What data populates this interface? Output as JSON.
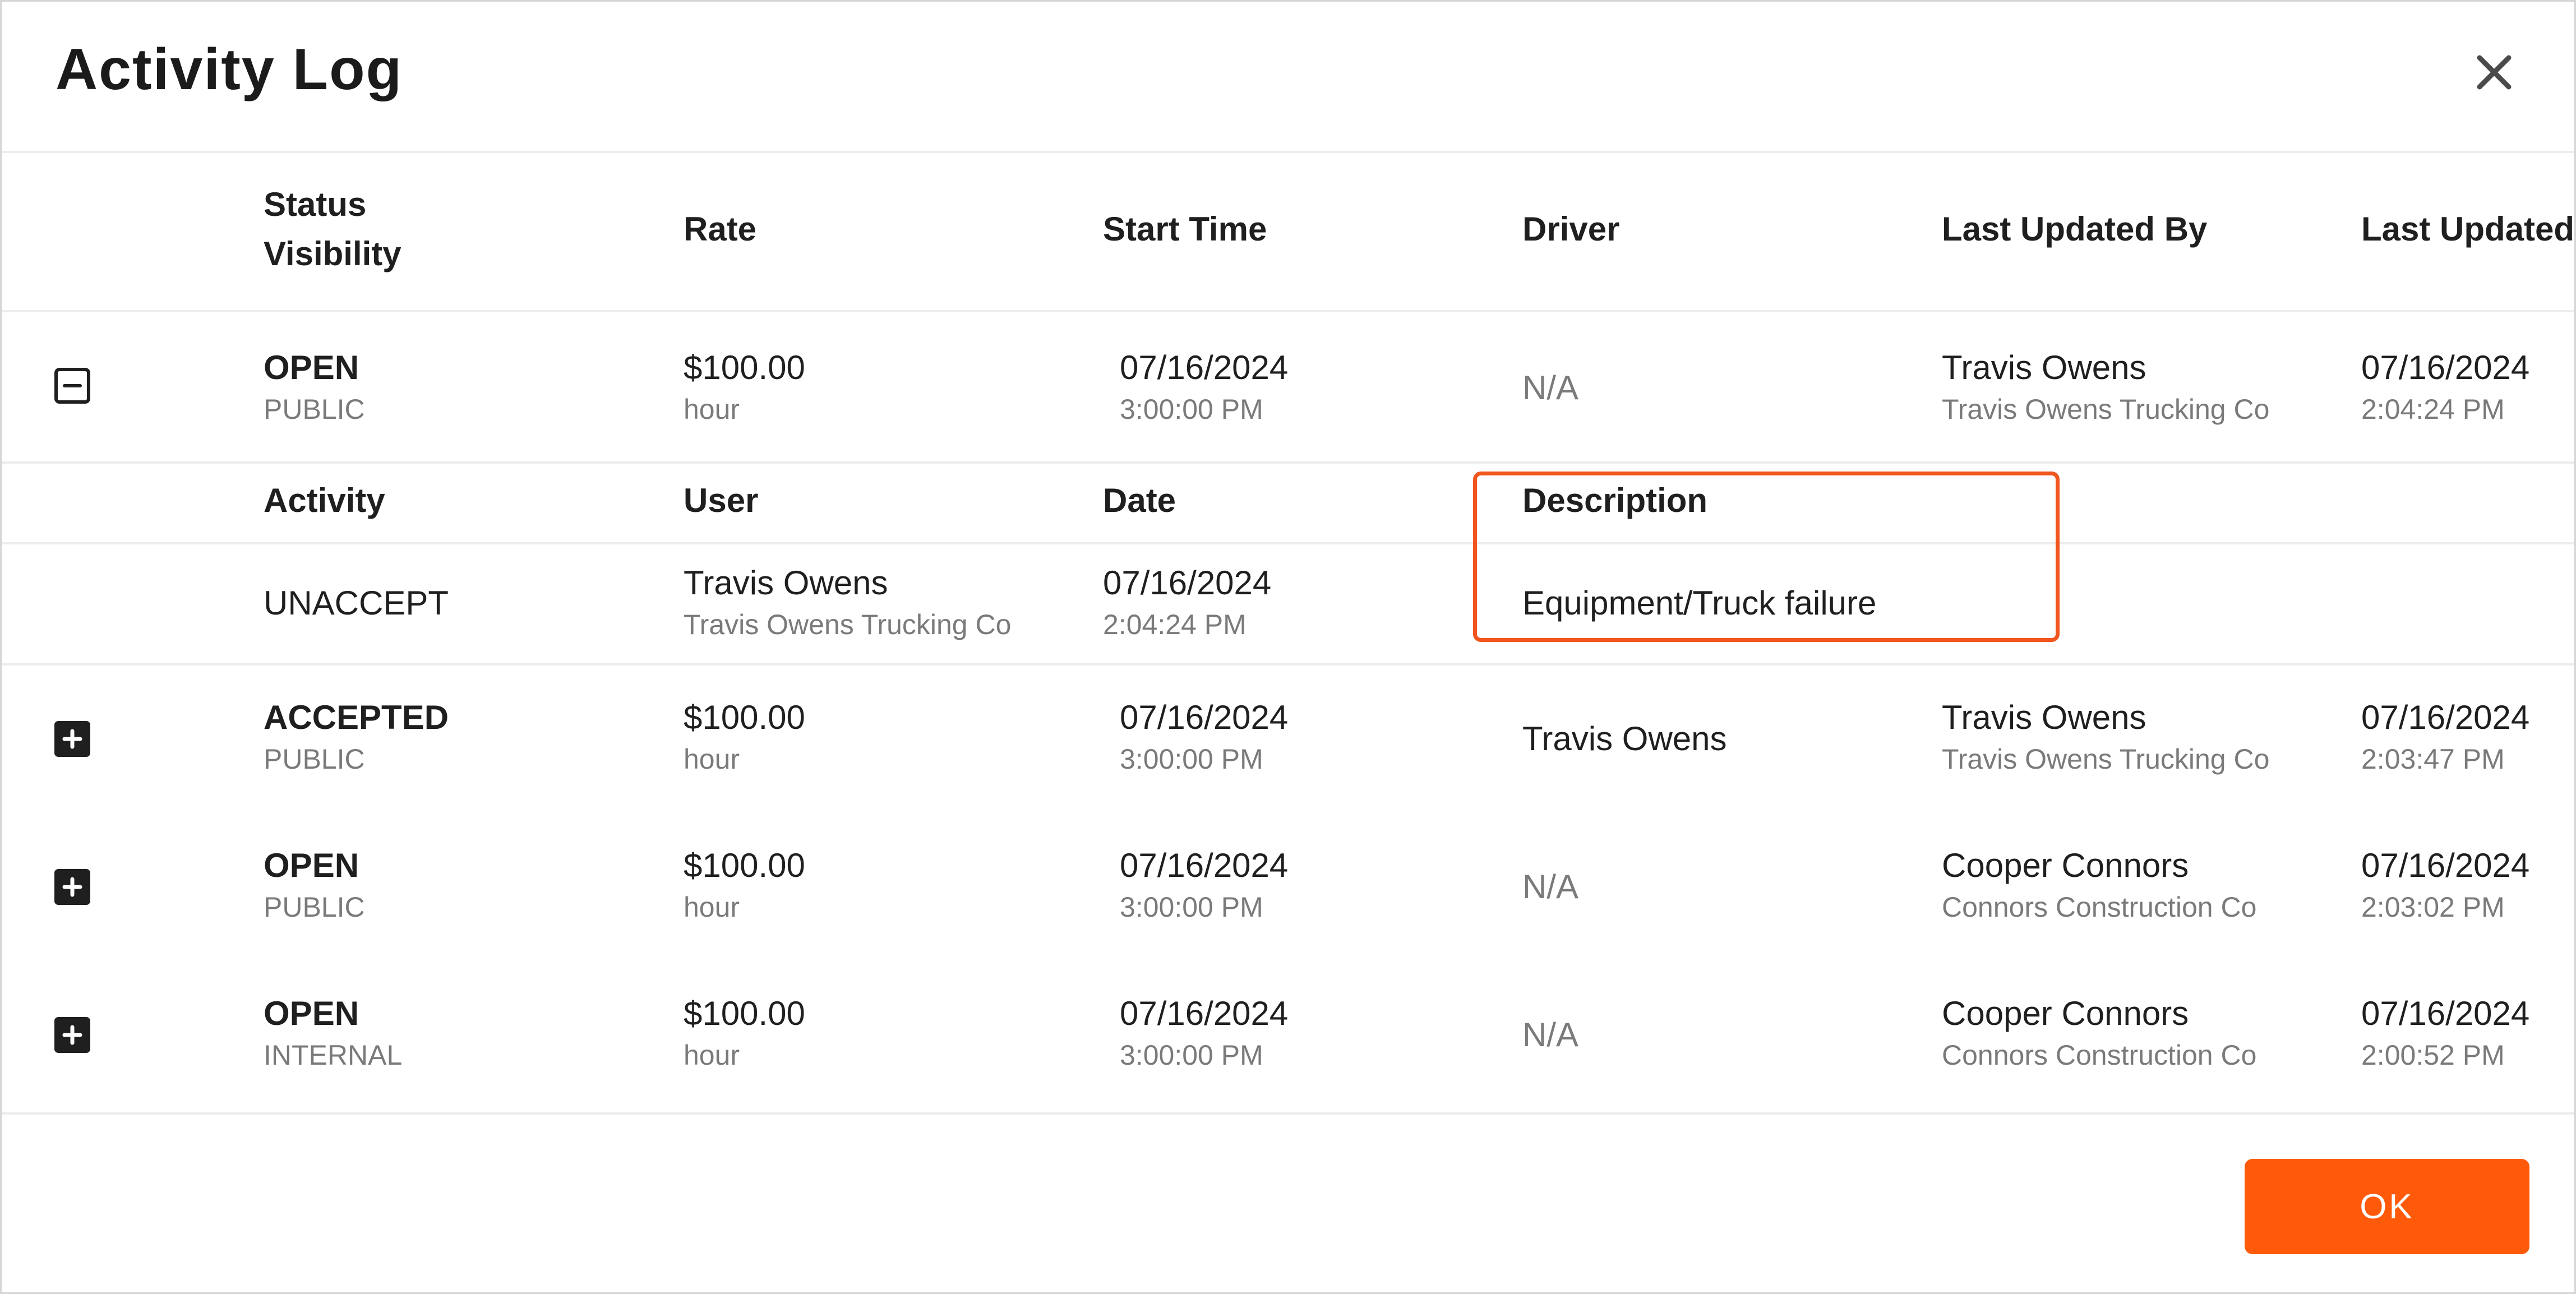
{
  "dialog": {
    "title": "Activity Log",
    "ok_label": "OK"
  },
  "columns": {
    "status": "Status",
    "visibility": "Visibility",
    "rate": "Rate",
    "start_time": "Start Time",
    "driver": "Driver",
    "last_updated_by": "Last Updated By",
    "last_updated": "Last Updated"
  },
  "rows": [
    {
      "expanded": true,
      "status": "OPEN",
      "visibility": "PUBLIC",
      "rate": "$100.00",
      "rate_unit": "hour",
      "start_date": "07/16/2024",
      "start_time": "3:00:00 PM",
      "driver": "N/A",
      "updated_by": "Travis Owens",
      "updated_by_company": "Travis Owens Trucking Co",
      "updated_date": "07/16/2024",
      "updated_time": "2:04:24 PM"
    },
    {
      "expanded": false,
      "status": "ACCEPTED",
      "visibility": "PUBLIC",
      "rate": "$100.00",
      "rate_unit": "hour",
      "start_date": "07/16/2024",
      "start_time": "3:00:00 PM",
      "driver": "Travis Owens",
      "updated_by": "Travis Owens",
      "updated_by_company": "Travis Owens Trucking Co",
      "updated_date": "07/16/2024",
      "updated_time": "2:03:47 PM"
    },
    {
      "expanded": false,
      "status": "OPEN",
      "visibility": "PUBLIC",
      "rate": "$100.00",
      "rate_unit": "hour",
      "start_date": "07/16/2024",
      "start_time": "3:00:00 PM",
      "driver": "N/A",
      "updated_by": "Cooper Connors",
      "updated_by_company": "Connors Construction Co",
      "updated_date": "07/16/2024",
      "updated_time": "2:03:02 PM"
    },
    {
      "expanded": false,
      "status": "OPEN",
      "visibility": "INTERNAL",
      "rate": "$100.00",
      "rate_unit": "hour",
      "start_date": "07/16/2024",
      "start_time": "3:00:00 PM",
      "driver": "N/A",
      "updated_by": "Cooper Connors",
      "updated_by_company": "Connors Construction Co",
      "updated_date": "07/16/2024",
      "updated_time": "2:00:52 PM"
    }
  ],
  "detail": {
    "headers": {
      "activity": "Activity",
      "user": "User",
      "date": "Date",
      "description": "Description"
    },
    "entry": {
      "activity": "UNACCEPT",
      "user": "Travis Owens",
      "user_company": "Travis Owens Trucking Co",
      "date": "07/16/2024",
      "time": "2:04:24 PM",
      "description": "Equipment/Truck failure"
    }
  },
  "icons": {
    "close": "close-icon",
    "expand": "plus-square-icon",
    "collapse": "minus-square-icon"
  },
  "colors": {
    "accent": "#ff5a0a",
    "highlight": "#f0561d"
  }
}
